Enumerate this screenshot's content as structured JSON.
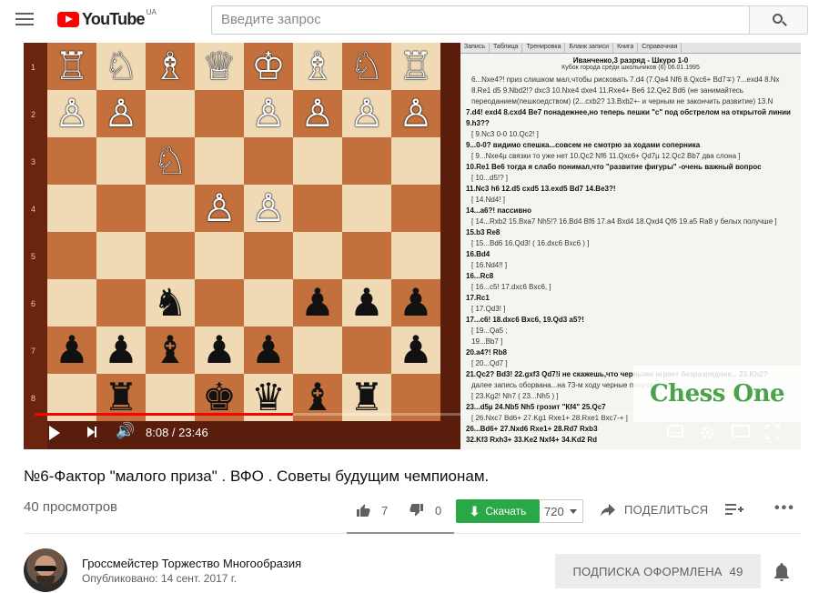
{
  "header": {
    "logo_text": "YouTube",
    "region": "UA",
    "search_placeholder": "Введите запрос"
  },
  "video": {
    "time": "8:08 / 23:46",
    "progress": 0.342,
    "overlay_brand": "Chess One",
    "board": [
      [
        "R",
        "N",
        "B",
        "Q",
        "K",
        "B",
        "N",
        "R"
      ],
      [
        "P",
        "P",
        "",
        "",
        "P",
        "P",
        "P",
        "P"
      ],
      [
        "",
        "",
        "N",
        "",
        "",
        "",
        "",
        ""
      ],
      [
        "",
        "",
        "",
        "P",
        "P",
        "",
        "",
        ""
      ],
      [
        "",
        "",
        "",
        "",
        "",
        "",
        "",
        ""
      ],
      [
        "",
        "",
        "n",
        "",
        "",
        "p",
        "p",
        "p"
      ],
      [
        "p",
        "p",
        "b",
        "p",
        "p",
        "",
        "",
        "p"
      ],
      [
        "",
        "r",
        "",
        "k",
        "q",
        "b",
        "r",
        ""
      ]
    ],
    "notes": {
      "tabs": [
        "Запись",
        "Таблица",
        "Тренировка",
        "Бланк записи",
        "Книга",
        "Справочная"
      ],
      "heading": "Иванченко,3 разряд - Шкуро  1-0",
      "subheading": "Кубок города среди школьников (6) 06.01.1995",
      "lines": [
        {
          "t": "v",
          "text": "6...Nxe4?! приз слишком мал,чтобы рисковать  7.d4 (7.Qa4 Nf6 8.Qxc6+ Bd7∓) 7...exd4 8.Nx"
        },
        {
          "t": "v",
          "text": "8.Re1 d5 9.Nbd2!? dxc3 10.Nxe4 dxe4 11.Rxe4+ Be6 12.Qe2 Bd6 (не занимайтесь"
        },
        {
          "t": "v",
          "text": "переоданием(пешкоедством) (2...cxb2? 13.Bxb2+- и черным не закончить развитие) 13.N"
        },
        {
          "t": "m",
          "text": "7.d4! exd4 8.cxd4 Be7 понадежнее,но теперь пешки \"c\" под обстрелом на открытой линии"
        },
        {
          "t": "m",
          "text": "9.h3??"
        },
        {
          "t": "v",
          "text": "[ 9.Nc3 0-0 10.Qc2! ]"
        },
        {
          "t": "m",
          "text": "9...0-0? видимо спешка...совсем не смотрю за ходами соперника"
        },
        {
          "t": "v",
          "text": "[ 9...Nxe4µ связки то уже нет  10.Qc2 Nf6 11.Qxc6+ Qd7µ 12.Qc2 Bb7 два слона ]"
        },
        {
          "t": "m",
          "text": "10.Re1 Be6 тогда я слабо понимал,что \"развитие фигуры\" -очень важный вопрос"
        },
        {
          "t": "v",
          "text": "[ 10...d5!? ]"
        },
        {
          "t": "m",
          "text": "11.Nc3 h6 12.d5 cxd5 13.exd5 Bd7 14.Be3?!"
        },
        {
          "t": "v",
          "text": "[ 14.Nd4! ]"
        },
        {
          "t": "m",
          "text": "14...a6?! пассивно"
        },
        {
          "t": "v",
          "text": "[ 14...Rxb2 15.Bxa7 Nh5!? 16.Bd4 Bf6 17.a4 Bxd4 18.Qxd4 Qf6 19.a5 Ra8 у белых получше ]"
        },
        {
          "t": "m",
          "text": "15.b3 Re8"
        },
        {
          "t": "v",
          "text": "[ 15...Bd6 16.Qd3! ( 16.dxc6 Bxc6 ) ]"
        },
        {
          "t": "m",
          "text": "16.Bd4"
        },
        {
          "t": "v",
          "text": "[ 16.Nd4!! ]"
        },
        {
          "t": "m",
          "text": "16...Rc8"
        },
        {
          "t": "v",
          "text": "[ 16...c5! 17.dxc6 Bxc6, ]"
        },
        {
          "t": "m",
          "text": "17.Rc1"
        },
        {
          "t": "v",
          "text": "[ 17.Qd3! ]"
        },
        {
          "t": "m",
          "text": "17...c6! 18.dxc6 Bxc6, 19.Qd3 a5?!"
        },
        {
          "t": "v",
          "text": "[ 19...Qa5 ;"
        },
        {
          "t": "v",
          "text": "19...Bb7 ]"
        },
        {
          "t": "m",
          "text": "20.a4?! Rb8"
        },
        {
          "t": "v",
          "text": "[ 20...Qd7 ]"
        },
        {
          "t": "m",
          "text": "21.Qc2? Bd3! 22.gxf3 Qd7!i не скажешь,что черными играет безразрядник...  23.Kh2?"
        },
        {
          "t": "v",
          "text": "далее запись оборвана...на 73-м ходу черные получили мат"
        },
        {
          "t": "v",
          "text": "[ 23.Kg2! Nh7 ( 23...Nh5 ) ]"
        },
        {
          "t": "m",
          "text": "23...d5µ 24.Nb5 Nh5 грозит \"Кf4\" 25.Qc7"
        },
        {
          "t": "v",
          "text": "[ 26.Nxc7 Bd6+ 27.Kg1 Rxe1+ 28.Rxe1 Bxc7-+ ]"
        },
        {
          "t": "m",
          "text": "26...Bd6+ 27.Nxd6 Rxe1+ 28.Rd7 Rxb3"
        },
        {
          "t": "m",
          "text": "32.Kf3 Rxh3+ 33.Ke2 Nxf4+ 34.Kd2 Rd"
        }
      ]
    }
  },
  "meta": {
    "title": "№6-Фактор \"малого приза\" . ВФО . Советы будущим чемпионам.",
    "views": "40 просмотров",
    "likes": "7",
    "dislikes": "0",
    "download_label": "Скачать",
    "download_count": "720",
    "share_label": "ПОДЕЛИТЬСЯ"
  },
  "channel": {
    "name": "Гроссмейстер Торжество Многообразия",
    "published": "Опубликовано: 14 сент. 2017 г.",
    "subscribe_label": "ПОДПИСКА ОФОРМЛЕНА",
    "subscribers": "49"
  },
  "colors": {
    "brand_red": "#ff0000",
    "download_green": "#2aa847"
  }
}
